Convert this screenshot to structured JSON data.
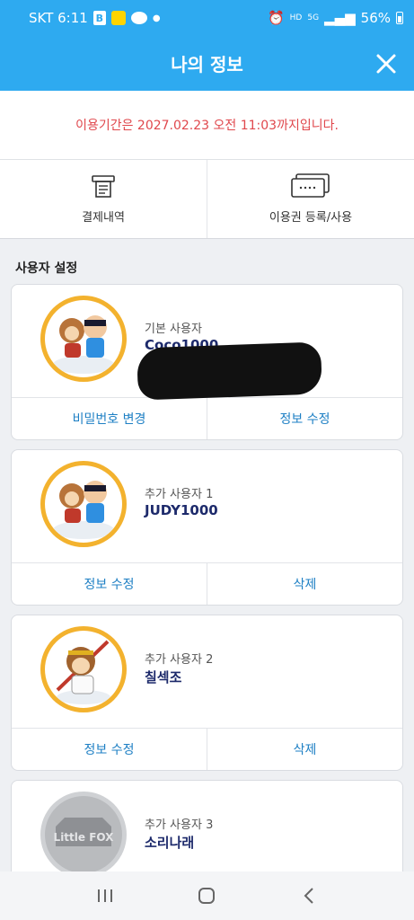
{
  "status": {
    "carrier_time": "SKT 6:11",
    "b_icon": "B",
    "battery": "56%",
    "hd": "HD",
    "lte": "5G"
  },
  "header": {
    "title": "나의 정보"
  },
  "expiry": {
    "text": "이용기간은 2027.02.23 오전 11:03까지입니다."
  },
  "actions": [
    {
      "label": "결제내역",
      "icon": "receipt-icon"
    },
    {
      "label": "이용권 등록/사용",
      "icon": "ticket-icon"
    }
  ],
  "section": {
    "title": "사용자 설정"
  },
  "users": [
    {
      "role": "기본 사용자",
      "name": "Coco1000",
      "buttons": [
        "비밀번호 변경",
        "정보 수정"
      ]
    },
    {
      "role": "추가 사용자 1",
      "name": "JUDY1000",
      "buttons": [
        "정보 수정",
        "삭제"
      ]
    },
    {
      "role": "추가 사용자 2",
      "name": "칠섹조",
      "buttons": [
        "정보 수정",
        "삭제"
      ]
    },
    {
      "role": "추가 사용자 3",
      "name": "소리나래"
    }
  ],
  "logo_text": "Little FOX",
  "colors": {
    "brand": "#2eaaf0",
    "expiry": "#e0474c",
    "link": "#1d7fc4",
    "name": "#1d2a6b"
  }
}
